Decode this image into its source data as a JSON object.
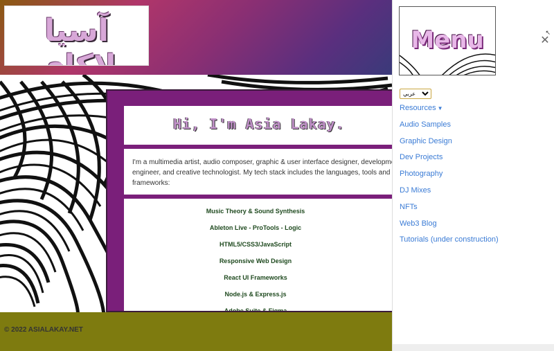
{
  "header": {
    "logo_text": "آسيا لاكاي"
  },
  "content": {
    "title": "Hi, I'm Asia Lakay.",
    "bio": "I'm a multimedia artist, audio composer, graphic & user interface designer, development engineer, and creative technologist. My tech stack includes the languages, tools and frameworks:",
    "skills": [
      "Music Theory & Sound Synthesis",
      "Ableton Live - ProTools - Logic",
      "HTML5/CSS3/JavaScript",
      "Responsive Web Design",
      "React UI Frameworks",
      "Node.js & Express.js",
      "Adobe Suite & Figma"
    ]
  },
  "footer": {
    "text": "© 2022 ASIALAKAY.NET"
  },
  "menu": {
    "logo_text": "Menu",
    "close_label": "✕",
    "language_selected": "عربي",
    "resources_label": "Resources",
    "items": [
      "Audio Samples",
      "Graphic Design",
      "Dev Projects",
      "Photography",
      "DJ Mixes",
      "NFTs",
      "Web3 Blog",
      "Tutorials (under construction)"
    ]
  },
  "colors": {
    "link": "#3a7bd5",
    "panel": "#7a1f7a",
    "footer": "#7e7b0f"
  }
}
